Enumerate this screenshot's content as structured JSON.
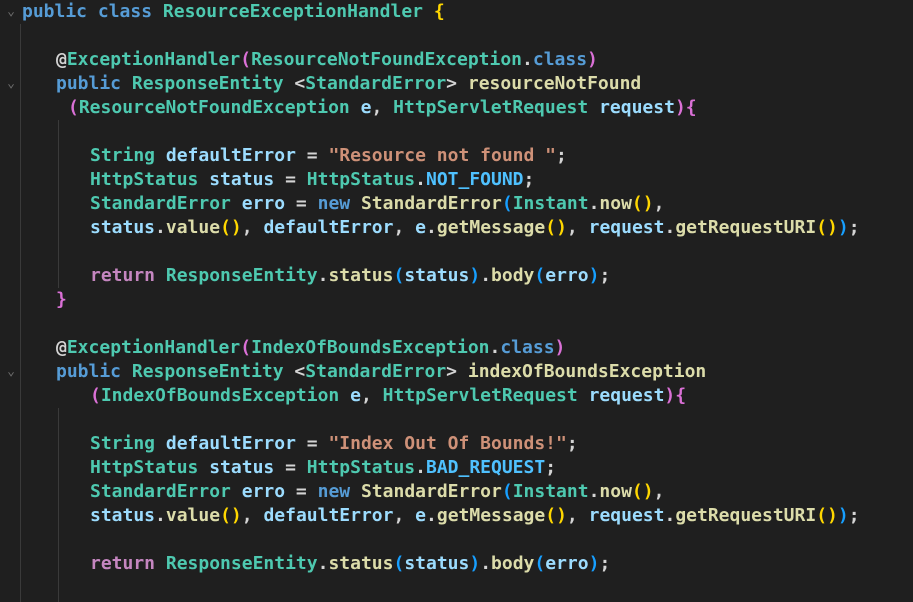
{
  "editor": {
    "language": "java",
    "theme_colors": {
      "background": "#1f1f1f",
      "keyword": "#569cd6",
      "type": "#4ec9b0",
      "function": "#dcdcaa",
      "string": "#ce9178",
      "variable": "#9cdcfe",
      "constant": "#4fc1ff",
      "control": "#c586c0",
      "bracket_1": "#ffd700",
      "bracket_2": "#da70d6",
      "bracket_3": "#179fff"
    },
    "fold_icon": "chevron-down-icon",
    "lines": [
      {
        "tokens": [
          {
            "t": "public",
            "c": "kw"
          },
          {
            "t": " "
          },
          {
            "t": "class",
            "c": "kw"
          },
          {
            "t": " "
          },
          {
            "t": "ResourceExceptionHandler",
            "c": "ty"
          },
          {
            "t": " "
          },
          {
            "t": "{",
            "c": "b1"
          }
        ]
      },
      {
        "tokens": []
      },
      {
        "tokens": [
          {
            "t": "@",
            "c": "ann"
          },
          {
            "t": "ExceptionHandler",
            "c": "ty"
          },
          {
            "t": "(",
            "c": "b2"
          },
          {
            "t": "ResourceNotFoundException",
            "c": "ty"
          },
          {
            "t": "."
          },
          {
            "t": "class",
            "c": "kw"
          },
          {
            "t": ")",
            "c": "b2"
          }
        ]
      },
      {
        "tokens": [
          {
            "t": "public",
            "c": "kw"
          },
          {
            "t": " "
          },
          {
            "t": "ResponseEntity",
            "c": "ty"
          },
          {
            "t": " <"
          },
          {
            "t": "StandardError",
            "c": "ty"
          },
          {
            "t": "> "
          },
          {
            "t": "resourceNotFound",
            "c": "fn"
          }
        ]
      },
      {
        "tokens": [
          {
            "t": "(",
            "c": "b2"
          },
          {
            "t": "ResourceNotFoundException",
            "c": "ty"
          },
          {
            "t": " "
          },
          {
            "t": "e",
            "c": "var"
          },
          {
            "t": ", "
          },
          {
            "t": "HttpServletRequest",
            "c": "ty"
          },
          {
            "t": " "
          },
          {
            "t": "request",
            "c": "var"
          },
          {
            "t": ")",
            "c": "b2"
          },
          {
            "t": "{",
            "c": "b2"
          }
        ]
      },
      {
        "tokens": []
      },
      {
        "tokens": [
          {
            "t": "String",
            "c": "ty"
          },
          {
            "t": " "
          },
          {
            "t": "defaultError",
            "c": "var"
          },
          {
            "t": " = "
          },
          {
            "t": "\"Resource not found \"",
            "c": "str"
          },
          {
            "t": ";"
          }
        ]
      },
      {
        "tokens": [
          {
            "t": "HttpStatus",
            "c": "ty"
          },
          {
            "t": " "
          },
          {
            "t": "status",
            "c": "var"
          },
          {
            "t": " = "
          },
          {
            "t": "HttpStatus",
            "c": "ty"
          },
          {
            "t": "."
          },
          {
            "t": "NOT_FOUND",
            "c": "const"
          },
          {
            "t": ";"
          }
        ]
      },
      {
        "tokens": [
          {
            "t": "StandardError",
            "c": "ty"
          },
          {
            "t": " "
          },
          {
            "t": "erro",
            "c": "var"
          },
          {
            "t": " = "
          },
          {
            "t": "new",
            "c": "kw"
          },
          {
            "t": " "
          },
          {
            "t": "StandardError",
            "c": "fn"
          },
          {
            "t": "(",
            "c": "b3"
          },
          {
            "t": "Instant",
            "c": "ty"
          },
          {
            "t": "."
          },
          {
            "t": "now",
            "c": "fn"
          },
          {
            "t": "()",
            "c": "b1"
          },
          {
            "t": ","
          }
        ]
      },
      {
        "tokens": [
          {
            "t": "status",
            "c": "var"
          },
          {
            "t": "."
          },
          {
            "t": "value",
            "c": "fn"
          },
          {
            "t": "()",
            "c": "b1"
          },
          {
            "t": ", "
          },
          {
            "t": "defaultError",
            "c": "var"
          },
          {
            "t": ", "
          },
          {
            "t": "e",
            "c": "var"
          },
          {
            "t": "."
          },
          {
            "t": "getMessage",
            "c": "fn"
          },
          {
            "t": "()",
            "c": "b1"
          },
          {
            "t": ", "
          },
          {
            "t": "request",
            "c": "var"
          },
          {
            "t": "."
          },
          {
            "t": "getRequestURI",
            "c": "fn"
          },
          {
            "t": "()",
            "c": "b1"
          },
          {
            "t": ")",
            "c": "b3"
          },
          {
            "t": ";"
          }
        ]
      },
      {
        "tokens": []
      },
      {
        "tokens": [
          {
            "t": "return",
            "c": "ctl"
          },
          {
            "t": " "
          },
          {
            "t": "ResponseEntity",
            "c": "ty"
          },
          {
            "t": "."
          },
          {
            "t": "status",
            "c": "fn"
          },
          {
            "t": "(",
            "c": "b3"
          },
          {
            "t": "status",
            "c": "var"
          },
          {
            "t": ")",
            "c": "b3"
          },
          {
            "t": "."
          },
          {
            "t": "body",
            "c": "fn"
          },
          {
            "t": "(",
            "c": "b3"
          },
          {
            "t": "erro",
            "c": "var"
          },
          {
            "t": ")",
            "c": "b3"
          },
          {
            "t": ";"
          }
        ]
      },
      {
        "tokens": [
          {
            "t": "}",
            "c": "b2"
          }
        ]
      },
      {
        "tokens": []
      },
      {
        "tokens": [
          {
            "t": "@",
            "c": "ann"
          },
          {
            "t": "ExceptionHandler",
            "c": "ty"
          },
          {
            "t": "(",
            "c": "b2"
          },
          {
            "t": "IndexOfBoundsException",
            "c": "ty"
          },
          {
            "t": "."
          },
          {
            "t": "class",
            "c": "kw"
          },
          {
            "t": ")",
            "c": "b2"
          }
        ]
      },
      {
        "tokens": [
          {
            "t": "public",
            "c": "kw"
          },
          {
            "t": " "
          },
          {
            "t": "ResponseEntity",
            "c": "ty"
          },
          {
            "t": " <"
          },
          {
            "t": "StandardError",
            "c": "ty"
          },
          {
            "t": "> "
          },
          {
            "t": "indexOfBoundsException",
            "c": "fn"
          }
        ]
      },
      {
        "tokens": [
          {
            "t": "(",
            "c": "b2"
          },
          {
            "t": "IndexOfBoundsException",
            "c": "ty"
          },
          {
            "t": " "
          },
          {
            "t": "e",
            "c": "var"
          },
          {
            "t": ", "
          },
          {
            "t": "HttpServletRequest",
            "c": "ty"
          },
          {
            "t": " "
          },
          {
            "t": "request",
            "c": "var"
          },
          {
            "t": ")",
            "c": "b2"
          },
          {
            "t": "{",
            "c": "b2"
          }
        ]
      },
      {
        "tokens": []
      },
      {
        "tokens": [
          {
            "t": "String",
            "c": "ty"
          },
          {
            "t": " "
          },
          {
            "t": "defaultError",
            "c": "var"
          },
          {
            "t": " = "
          },
          {
            "t": "\"Index Out Of Bounds!\"",
            "c": "str"
          },
          {
            "t": ";"
          }
        ]
      },
      {
        "tokens": [
          {
            "t": "HttpStatus",
            "c": "ty"
          },
          {
            "t": " "
          },
          {
            "t": "status",
            "c": "var"
          },
          {
            "t": " = "
          },
          {
            "t": "HttpStatus",
            "c": "ty"
          },
          {
            "t": "."
          },
          {
            "t": "BAD_REQUEST",
            "c": "const"
          },
          {
            "t": ";"
          }
        ]
      },
      {
        "tokens": [
          {
            "t": "StandardError",
            "c": "ty"
          },
          {
            "t": " "
          },
          {
            "t": "erro",
            "c": "var"
          },
          {
            "t": " = "
          },
          {
            "t": "new",
            "c": "kw"
          },
          {
            "t": " "
          },
          {
            "t": "StandardError",
            "c": "fn"
          },
          {
            "t": "(",
            "c": "b3"
          },
          {
            "t": "Instant",
            "c": "ty"
          },
          {
            "t": "."
          },
          {
            "t": "now",
            "c": "fn"
          },
          {
            "t": "()",
            "c": "b1"
          },
          {
            "t": ","
          }
        ]
      },
      {
        "tokens": [
          {
            "t": "status",
            "c": "var"
          },
          {
            "t": "."
          },
          {
            "t": "value",
            "c": "fn"
          },
          {
            "t": "()",
            "c": "b1"
          },
          {
            "t": ", "
          },
          {
            "t": "defaultError",
            "c": "var"
          },
          {
            "t": ", "
          },
          {
            "t": "e",
            "c": "var"
          },
          {
            "t": "."
          },
          {
            "t": "getMessage",
            "c": "fn"
          },
          {
            "t": "()",
            "c": "b1"
          },
          {
            "t": ", "
          },
          {
            "t": "request",
            "c": "var"
          },
          {
            "t": "."
          },
          {
            "t": "getRequestURI",
            "c": "fn"
          },
          {
            "t": "()",
            "c": "b1"
          },
          {
            "t": ")",
            "c": "b3"
          },
          {
            "t": ";"
          }
        ]
      },
      {
        "tokens": []
      },
      {
        "tokens": [
          {
            "t": "return",
            "c": "ctl"
          },
          {
            "t": " "
          },
          {
            "t": "ResponseEntity",
            "c": "ty"
          },
          {
            "t": "."
          },
          {
            "t": "status",
            "c": "fn"
          },
          {
            "t": "(",
            "c": "b3"
          },
          {
            "t": "status",
            "c": "var"
          },
          {
            "t": ")",
            "c": "b3"
          },
          {
            "t": "."
          },
          {
            "t": "body",
            "c": "fn"
          },
          {
            "t": "(",
            "c": "b3"
          },
          {
            "t": "erro",
            "c": "var"
          },
          {
            "t": ")",
            "c": "b3"
          },
          {
            "t": ";"
          }
        ]
      }
    ]
  }
}
